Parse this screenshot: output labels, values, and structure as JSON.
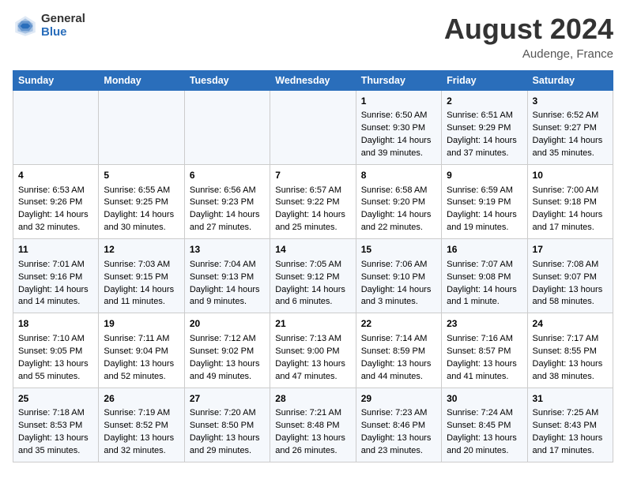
{
  "header": {
    "logo_general": "General",
    "logo_blue": "Blue",
    "month_year": "August 2024",
    "location": "Audenge, France"
  },
  "days_of_week": [
    "Sunday",
    "Monday",
    "Tuesday",
    "Wednesday",
    "Thursday",
    "Friday",
    "Saturday"
  ],
  "weeks": [
    [
      {
        "day": "",
        "content": ""
      },
      {
        "day": "",
        "content": ""
      },
      {
        "day": "",
        "content": ""
      },
      {
        "day": "",
        "content": ""
      },
      {
        "day": "1",
        "content": "Sunrise: 6:50 AM\nSunset: 9:30 PM\nDaylight: 14 hours and 39 minutes."
      },
      {
        "day": "2",
        "content": "Sunrise: 6:51 AM\nSunset: 9:29 PM\nDaylight: 14 hours and 37 minutes."
      },
      {
        "day": "3",
        "content": "Sunrise: 6:52 AM\nSunset: 9:27 PM\nDaylight: 14 hours and 35 minutes."
      }
    ],
    [
      {
        "day": "4",
        "content": "Sunrise: 6:53 AM\nSunset: 9:26 PM\nDaylight: 14 hours and 32 minutes."
      },
      {
        "day": "5",
        "content": "Sunrise: 6:55 AM\nSunset: 9:25 PM\nDaylight: 14 hours and 30 minutes."
      },
      {
        "day": "6",
        "content": "Sunrise: 6:56 AM\nSunset: 9:23 PM\nDaylight: 14 hours and 27 minutes."
      },
      {
        "day": "7",
        "content": "Sunrise: 6:57 AM\nSunset: 9:22 PM\nDaylight: 14 hours and 25 minutes."
      },
      {
        "day": "8",
        "content": "Sunrise: 6:58 AM\nSunset: 9:20 PM\nDaylight: 14 hours and 22 minutes."
      },
      {
        "day": "9",
        "content": "Sunrise: 6:59 AM\nSunset: 9:19 PM\nDaylight: 14 hours and 19 minutes."
      },
      {
        "day": "10",
        "content": "Sunrise: 7:00 AM\nSunset: 9:18 PM\nDaylight: 14 hours and 17 minutes."
      }
    ],
    [
      {
        "day": "11",
        "content": "Sunrise: 7:01 AM\nSunset: 9:16 PM\nDaylight: 14 hours and 14 minutes."
      },
      {
        "day": "12",
        "content": "Sunrise: 7:03 AM\nSunset: 9:15 PM\nDaylight: 14 hours and 11 minutes."
      },
      {
        "day": "13",
        "content": "Sunrise: 7:04 AM\nSunset: 9:13 PM\nDaylight: 14 hours and 9 minutes."
      },
      {
        "day": "14",
        "content": "Sunrise: 7:05 AM\nSunset: 9:12 PM\nDaylight: 14 hours and 6 minutes."
      },
      {
        "day": "15",
        "content": "Sunrise: 7:06 AM\nSunset: 9:10 PM\nDaylight: 14 hours and 3 minutes."
      },
      {
        "day": "16",
        "content": "Sunrise: 7:07 AM\nSunset: 9:08 PM\nDaylight: 14 hours and 1 minute."
      },
      {
        "day": "17",
        "content": "Sunrise: 7:08 AM\nSunset: 9:07 PM\nDaylight: 13 hours and 58 minutes."
      }
    ],
    [
      {
        "day": "18",
        "content": "Sunrise: 7:10 AM\nSunset: 9:05 PM\nDaylight: 13 hours and 55 minutes."
      },
      {
        "day": "19",
        "content": "Sunrise: 7:11 AM\nSunset: 9:04 PM\nDaylight: 13 hours and 52 minutes."
      },
      {
        "day": "20",
        "content": "Sunrise: 7:12 AM\nSunset: 9:02 PM\nDaylight: 13 hours and 49 minutes."
      },
      {
        "day": "21",
        "content": "Sunrise: 7:13 AM\nSunset: 9:00 PM\nDaylight: 13 hours and 47 minutes."
      },
      {
        "day": "22",
        "content": "Sunrise: 7:14 AM\nSunset: 8:59 PM\nDaylight: 13 hours and 44 minutes."
      },
      {
        "day": "23",
        "content": "Sunrise: 7:16 AM\nSunset: 8:57 PM\nDaylight: 13 hours and 41 minutes."
      },
      {
        "day": "24",
        "content": "Sunrise: 7:17 AM\nSunset: 8:55 PM\nDaylight: 13 hours and 38 minutes."
      }
    ],
    [
      {
        "day": "25",
        "content": "Sunrise: 7:18 AM\nSunset: 8:53 PM\nDaylight: 13 hours and 35 minutes."
      },
      {
        "day": "26",
        "content": "Sunrise: 7:19 AM\nSunset: 8:52 PM\nDaylight: 13 hours and 32 minutes."
      },
      {
        "day": "27",
        "content": "Sunrise: 7:20 AM\nSunset: 8:50 PM\nDaylight: 13 hours and 29 minutes."
      },
      {
        "day": "28",
        "content": "Sunrise: 7:21 AM\nSunset: 8:48 PM\nDaylight: 13 hours and 26 minutes."
      },
      {
        "day": "29",
        "content": "Sunrise: 7:23 AM\nSunset: 8:46 PM\nDaylight: 13 hours and 23 minutes."
      },
      {
        "day": "30",
        "content": "Sunrise: 7:24 AM\nSunset: 8:45 PM\nDaylight: 13 hours and 20 minutes."
      },
      {
        "day": "31",
        "content": "Sunrise: 7:25 AM\nSunset: 8:43 PM\nDaylight: 13 hours and 17 minutes."
      }
    ]
  ]
}
